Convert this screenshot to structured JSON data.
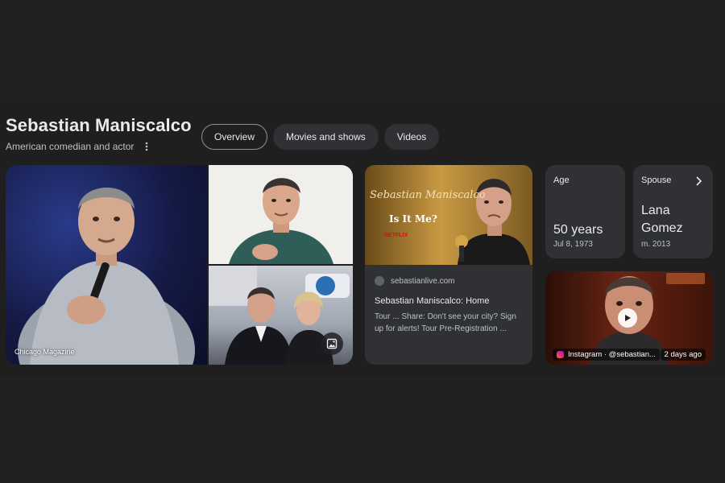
{
  "entity": {
    "name": "Sebastian Maniscalco",
    "description": "American comedian and actor"
  },
  "tabs": [
    {
      "label": "Overview",
      "active": true
    },
    {
      "label": "Movies and shows",
      "active": false
    },
    {
      "label": "Videos",
      "active": false
    }
  ],
  "images": {
    "main_caption": "Chicago Magazine",
    "poster": {
      "title": "Sebastian Maniscalco",
      "subtitle": "Is It Me?",
      "brand": "NETFLIX"
    }
  },
  "web_result": {
    "source": "sebastianlive.com",
    "title": "Sebastian Maniscalco: Home",
    "snippet": "Tour ... Share: Don't see your city? Sign up for alerts! Tour Pre-Registration ..."
  },
  "facts": {
    "age": {
      "label": "Age",
      "value": "50 years",
      "sub": "Jul 8, 1973"
    },
    "spouse": {
      "label": "Spouse",
      "value": "Lana Gomez",
      "sub": "m. 2013"
    }
  },
  "video": {
    "source": "Instagram · @sebastian...",
    "time": "2 days ago"
  },
  "colors": {
    "background": "#222021",
    "card": "#303134",
    "text": "#e8eaed",
    "muted": "#bdc1c6"
  }
}
